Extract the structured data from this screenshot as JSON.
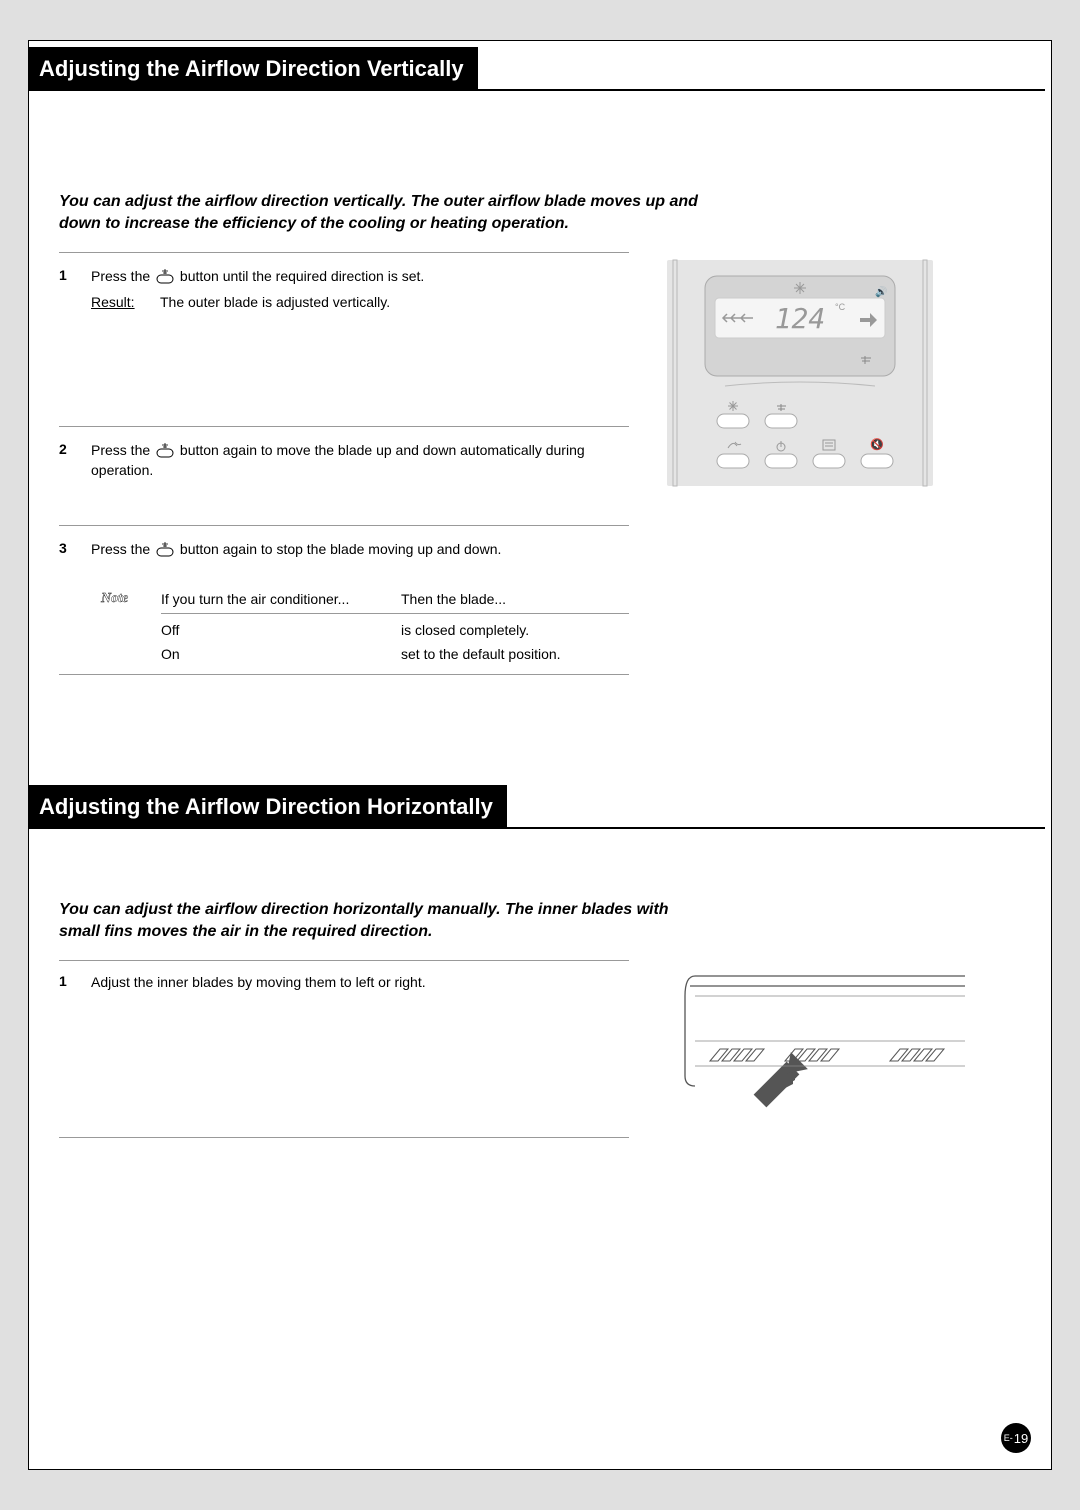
{
  "section1": {
    "title": "Adjusting the Airflow Direction Vertically",
    "intro": "You can adjust the airflow direction vertically. The outer airflow blade moves up and down to increase the efficiency of the cooling or heating operation.",
    "steps": [
      {
        "num": "1",
        "text_before": "Press the ",
        "text_after": " button until the required direction is set.",
        "result_label": "Result:",
        "result_text": "The outer blade is adjusted vertically."
      },
      {
        "num": "2",
        "text_before": "Press the ",
        "text_after": " button again to move the blade up and down automatically during operation."
      },
      {
        "num": "3",
        "text_before": "Press the ",
        "text_after": " button again to stop the blade moving up and down."
      }
    ],
    "note": {
      "label": "Note",
      "head_c1": "If you turn the air conditioner...",
      "head_c2": "Then the blade...",
      "rows": [
        {
          "c1": "Off",
          "c2": "is closed completely."
        },
        {
          "c1": "On",
          "c2": "set to the default position."
        }
      ]
    },
    "remote": {
      "temp": "124",
      "temp_unit": "°C"
    }
  },
  "section2": {
    "title": "Adjusting the Airflow Direction Horizontally",
    "intro": "You can adjust the airflow direction horizontally manually. The inner blades with small fins moves the air in the required direction.",
    "steps": [
      {
        "num": "1",
        "text": "Adjust the inner blades by moving them to left or right."
      }
    ]
  },
  "page_number": {
    "prefix": "E-",
    "num": "19"
  }
}
